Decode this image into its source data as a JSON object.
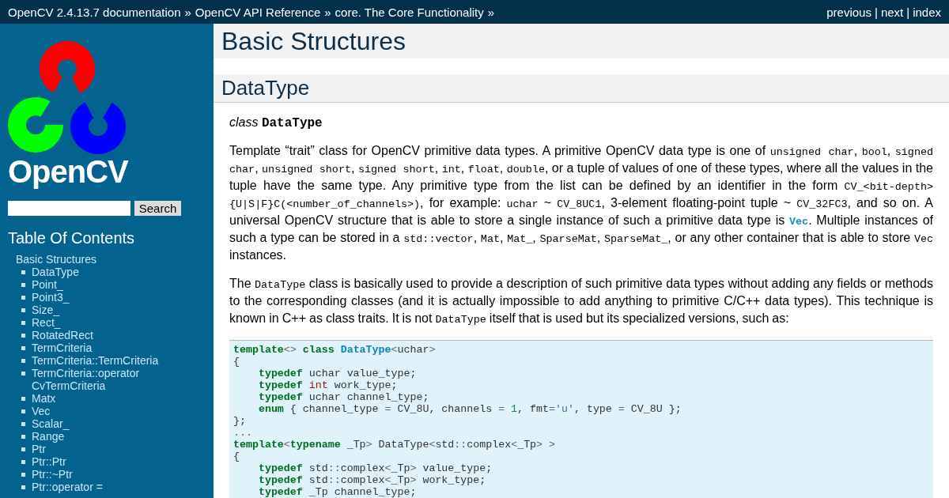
{
  "top_bar": {
    "breadcrumbs": [
      {
        "label": "OpenCV 2.4.13.7 documentation",
        "separator": "»"
      },
      {
        "label": "OpenCV API Reference",
        "separator": "»"
      },
      {
        "label": "core. The Core Functionality",
        "separator": "»"
      }
    ],
    "nav_links": [
      {
        "label": "previous",
        "separator": "|"
      },
      {
        "label": "next",
        "separator": "|"
      },
      {
        "label": "index"
      }
    ]
  },
  "sidebar": {
    "logo": {
      "wordmark": "OpenCV"
    },
    "search": {
      "button": "Search"
    },
    "toc_title": "Table Of Contents",
    "toc": [
      {
        "label": "Basic Structures",
        "children": [
          {
            "label": "DataType"
          },
          {
            "label": "Point_"
          },
          {
            "label": "Point3_"
          },
          {
            "label": "Size_"
          },
          {
            "label": "Rect_"
          },
          {
            "label": "RotatedRect"
          },
          {
            "label": "TermCriteria"
          },
          {
            "label": "TermCriteria::TermCriteria"
          },
          {
            "label": "TermCriteria::operator CvTermCriteria"
          },
          {
            "label": "Matx"
          },
          {
            "label": "Vec"
          },
          {
            "label": "Scalar_"
          },
          {
            "label": "Range"
          },
          {
            "label": "Ptr"
          },
          {
            "label": "Ptr::Ptr"
          },
          {
            "label": "Ptr::~Ptr"
          },
          {
            "label": "Ptr::operator ="
          }
        ]
      }
    ]
  },
  "main": {
    "title": "Basic Structures",
    "section_title": "DataType",
    "signature": {
      "keyword": "class",
      "name": "DataType"
    },
    "paragraphs": [
      {
        "segments": [
          {
            "kind": "text",
            "text": "Template “trait” class for OpenCV primitive data types. A primitive OpenCV data type is one of "
          },
          {
            "kind": "code",
            "text": "unsigned char"
          },
          {
            "kind": "text",
            "text": ", "
          },
          {
            "kind": "code",
            "text": "bool"
          },
          {
            "kind": "text",
            "text": ", "
          },
          {
            "kind": "code",
            "text": "signed char"
          },
          {
            "kind": "text",
            "text": ", "
          },
          {
            "kind": "code",
            "text": "unsigned short"
          },
          {
            "kind": "text",
            "text": ", "
          },
          {
            "kind": "code",
            "text": "signed short"
          },
          {
            "kind": "text",
            "text": ", "
          },
          {
            "kind": "code",
            "text": "int"
          },
          {
            "kind": "text",
            "text": ", "
          },
          {
            "kind": "code",
            "text": "float"
          },
          {
            "kind": "text",
            "text": ", "
          },
          {
            "kind": "code",
            "text": "double"
          },
          {
            "kind": "text",
            "text": ", or a tuple of values of one of these types, where all the values in the tuple have the same type. Any primitive type from the list can be defined by an identifier in the form "
          },
          {
            "kind": "code",
            "text": "CV_<bit-depth>{U|S|F}C(<number_of_channels>)"
          },
          {
            "kind": "text",
            "text": ", for example: "
          },
          {
            "kind": "code",
            "text": "uchar"
          },
          {
            "kind": "text",
            "text": " ~ "
          },
          {
            "kind": "code",
            "text": "CV_8UC1"
          },
          {
            "kind": "text",
            "text": ", 3-element floating-point tuple ~ "
          },
          {
            "kind": "code",
            "text": "CV_32FC3"
          },
          {
            "kind": "text",
            "text": ", and so on. A universal OpenCV structure that is able to store a single instance of such a primitive data type is "
          },
          {
            "kind": "link",
            "text": "Vec"
          },
          {
            "kind": "text",
            "text": ". Multiple instances of such a type can be stored in a "
          },
          {
            "kind": "code",
            "text": "std::vector"
          },
          {
            "kind": "text",
            "text": ", "
          },
          {
            "kind": "code",
            "text": "Mat"
          },
          {
            "kind": "text",
            "text": ", "
          },
          {
            "kind": "code",
            "text": "Mat_"
          },
          {
            "kind": "text",
            "text": ", "
          },
          {
            "kind": "code",
            "text": "SparseMat"
          },
          {
            "kind": "text",
            "text": ", "
          },
          {
            "kind": "code",
            "text": "SparseMat_"
          },
          {
            "kind": "text",
            "text": ", or any other container that is able to store "
          },
          {
            "kind": "code",
            "text": "Vec"
          },
          {
            "kind": "text",
            "text": " instances."
          }
        ]
      },
      {
        "segments": [
          {
            "kind": "text",
            "text": "The "
          },
          {
            "kind": "code",
            "text": "DataType"
          },
          {
            "kind": "text",
            "text": " class is basically used to provide a description of such primitive data types without adding any fields or methods to the corresponding classes (and it is actually impossible to add anything to primitive C/C++ data types). This technique is known in C++ as class traits. It is not "
          },
          {
            "kind": "code",
            "text": "DataType"
          },
          {
            "kind": "text",
            "text": " itself that is used but its specialized versions, such as:"
          }
        ]
      }
    ],
    "code_block": {
      "lines": [
        [
          {
            "kind": "keyword",
            "text": "template"
          },
          {
            "kind": "operator",
            "text": "<>"
          },
          {
            "kind": "keyword",
            "text": " class"
          },
          {
            "kind": "class",
            "text": " DataType"
          },
          {
            "kind": "operator",
            "text": "<"
          },
          {
            "kind": "plain",
            "text": "uchar"
          },
          {
            "kind": "operator",
            "text": ">"
          }
        ],
        [
          {
            "kind": "plain",
            "text": "{"
          }
        ],
        [
          {
            "kind": "keyword",
            "text": "    typedef"
          },
          {
            "kind": "plain",
            "text": " uchar value_type;"
          }
        ],
        [
          {
            "kind": "keyword",
            "text": "    typedef"
          },
          {
            "kind": "type",
            "text": " int"
          },
          {
            "kind": "plain",
            "text": " work_type;"
          }
        ],
        [
          {
            "kind": "keyword",
            "text": "    typedef"
          },
          {
            "kind": "plain",
            "text": " uchar channel_type;"
          }
        ],
        [
          {
            "kind": "keyword",
            "text": "    enum"
          },
          {
            "kind": "plain",
            "text": " { channel_type "
          },
          {
            "kind": "operator",
            "text": "="
          },
          {
            "kind": "plain",
            "text": " CV_8U, channels "
          },
          {
            "kind": "operator",
            "text": "="
          },
          {
            "kind": "number",
            "text": " 1"
          },
          {
            "kind": "plain",
            "text": ", fmt"
          },
          {
            "kind": "operator",
            "text": "="
          },
          {
            "kind": "string",
            "text": "'u'"
          },
          {
            "kind": "plain",
            "text": ", type "
          },
          {
            "kind": "operator",
            "text": "="
          },
          {
            "kind": "plain",
            "text": " CV_8U };"
          }
        ],
        [
          {
            "kind": "plain",
            "text": "};"
          }
        ],
        [
          {
            "kind": "operator",
            "text": "..."
          }
        ],
        [
          {
            "kind": "keyword",
            "text": "template"
          },
          {
            "kind": "operator",
            "text": "<"
          },
          {
            "kind": "keyword",
            "text": "typename"
          },
          {
            "kind": "plain",
            "text": " _Tp"
          },
          {
            "kind": "operator",
            "text": ">"
          },
          {
            "kind": "plain",
            "text": " DataType"
          },
          {
            "kind": "operator",
            "text": "<"
          },
          {
            "kind": "plain",
            "text": "std"
          },
          {
            "kind": "operator",
            "text": "::"
          },
          {
            "kind": "plain",
            "text": "complex"
          },
          {
            "kind": "operator",
            "text": "<"
          },
          {
            "kind": "plain",
            "text": "_Tp"
          },
          {
            "kind": "operator",
            "text": ">"
          },
          {
            "kind": "operator",
            "text": " >"
          }
        ],
        [
          {
            "kind": "plain",
            "text": "{"
          }
        ],
        [
          {
            "kind": "keyword",
            "text": "    typedef"
          },
          {
            "kind": "plain",
            "text": " std"
          },
          {
            "kind": "operator",
            "text": "::"
          },
          {
            "kind": "plain",
            "text": "complex"
          },
          {
            "kind": "operator",
            "text": "<"
          },
          {
            "kind": "plain",
            "text": "_Tp"
          },
          {
            "kind": "operator",
            "text": ">"
          },
          {
            "kind": "plain",
            "text": " value_type;"
          }
        ],
        [
          {
            "kind": "keyword",
            "text": "    typedef"
          },
          {
            "kind": "plain",
            "text": " std"
          },
          {
            "kind": "operator",
            "text": "::"
          },
          {
            "kind": "plain",
            "text": "complex"
          },
          {
            "kind": "operator",
            "text": "<"
          },
          {
            "kind": "plain",
            "text": "_Tp"
          },
          {
            "kind": "operator",
            "text": ">"
          },
          {
            "kind": "plain",
            "text": " work_type;"
          }
        ],
        [
          {
            "kind": "keyword",
            "text": "    typedef"
          },
          {
            "kind": "plain",
            "text": " _Tp channel_type;"
          }
        ]
      ]
    }
  }
}
